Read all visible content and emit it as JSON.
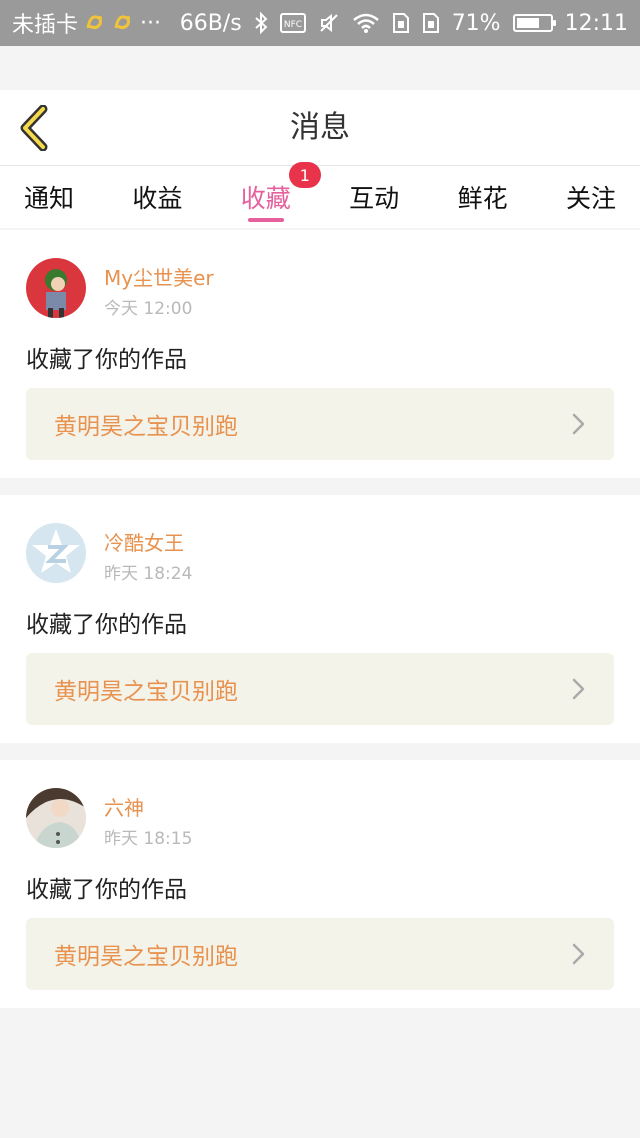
{
  "status_bar": {
    "carrier": "未插卡",
    "more": "···",
    "speed": "66B/s",
    "nfc": "NFC",
    "battery_percent": "71%",
    "battery_level": 0.71,
    "time": "12:11"
  },
  "header": {
    "title": "消息"
  },
  "tabs": [
    {
      "label": "通知"
    },
    {
      "label": "收益"
    },
    {
      "label": "收藏",
      "badge": "1"
    },
    {
      "label": "互动"
    },
    {
      "label": "鲜花"
    },
    {
      "label": "关注"
    }
  ],
  "messages": [
    {
      "name": "My尘世美er",
      "time": "今天 12:00",
      "action": "收藏了你的作品",
      "work_title": "黄明昊之宝贝别跑"
    },
    {
      "name": "冷酷女王",
      "time": "昨天 18:24",
      "action": "收藏了你的作品",
      "work_title": "黄明昊之宝贝别跑"
    },
    {
      "name": "六神",
      "time": "昨天 18:15",
      "action": "收藏了你的作品",
      "work_title": "黄明昊之宝贝别跑"
    }
  ],
  "colors": {
    "accent": "#e5609c",
    "badge": "#e8334a",
    "name": "#e8924f",
    "work_bg": "#f4f3ea"
  }
}
